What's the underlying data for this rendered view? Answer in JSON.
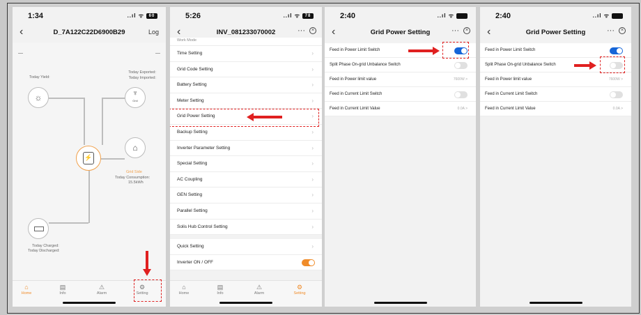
{
  "screen1": {
    "time": "1:34",
    "signal": "..ıl ᯤ",
    "battery": "60",
    "title": "D_7A122C22D6900B29",
    "right": "Log",
    "dash_left": "—",
    "dash_right": "—",
    "today_yield": "Today Yield:",
    "today_exported": "Today Exported:",
    "today_imported": "Today Imported:",
    "grid_icon_label": "Grid",
    "grid_side": "Grid Side",
    "today_consumption": "Today Consumption:",
    "consumption_value": "15.5kWh",
    "today_charged": "Today Charged:",
    "today_discharged": "Today Discharged:",
    "tabs": [
      {
        "label": "Home",
        "icon": "home-icon"
      },
      {
        "label": "Info",
        "icon": "info-icon"
      },
      {
        "label": "Alarm",
        "icon": "alarm-icon"
      },
      {
        "label": "Setting",
        "icon": "gear-icon"
      }
    ]
  },
  "screen2": {
    "time": "5:26",
    "signal": "..ıl ᯤ",
    "battery": "78",
    "title": "INV_081233070002",
    "partial_row": "Work Mode",
    "items": [
      "Time Setting",
      "Grid Code Setting",
      "Battery Setting",
      "Meter Setting",
      "Grid Power Setting",
      "Backup Setting",
      "Inverter Parameter Setting",
      "Special Setting",
      "AC Coupling",
      "GEN Setting",
      "Parallel Setting",
      "Solis Hub Control Setting"
    ],
    "quick_setting": "Quick Setting",
    "inverter_onoff": "Inverter ON / OFF",
    "tabs": [
      {
        "label": "Home",
        "icon": "home-icon"
      },
      {
        "label": "Info",
        "icon": "info-icon"
      },
      {
        "label": "Alarm",
        "icon": "alarm-icon"
      },
      {
        "label": "Setting",
        "icon": "gear-icon"
      }
    ]
  },
  "screen3": {
    "time": "2:40",
    "signal": "..ıl ᯤ",
    "title": "Grid Power Setting",
    "rows": [
      {
        "label": "Feed in Power Limit Switch",
        "toggle": "on"
      },
      {
        "label": "Split Phase On-grid Unbalance Switch",
        "toggle": "off"
      },
      {
        "label": "Feed in Power limit value",
        "value": "7600W >"
      },
      {
        "label": "Feed in Current Limit Switch",
        "toggle": "off"
      },
      {
        "label": "Feed in Current Limit Value",
        "value": "0.0A >"
      }
    ]
  },
  "screen4": {
    "time": "2:40",
    "signal": "..ıl ᯤ",
    "title": "Grid Power Setting",
    "rows": [
      {
        "label": "Feed in Power Limit Switch",
        "toggle": "on"
      },
      {
        "label": "Split Phase On-grid Unbalance Switch",
        "toggle": "off"
      },
      {
        "label": "Feed in Power limit value",
        "value": "7600W >"
      },
      {
        "label": "Feed in Current Limit Switch",
        "toggle": "off"
      },
      {
        "label": "Feed in Current Limit Value",
        "value": "0.0A >"
      }
    ]
  },
  "colors": {
    "accent": "#f08c2a",
    "toggle_on": "#1565d8",
    "annotation": "#e02020"
  }
}
